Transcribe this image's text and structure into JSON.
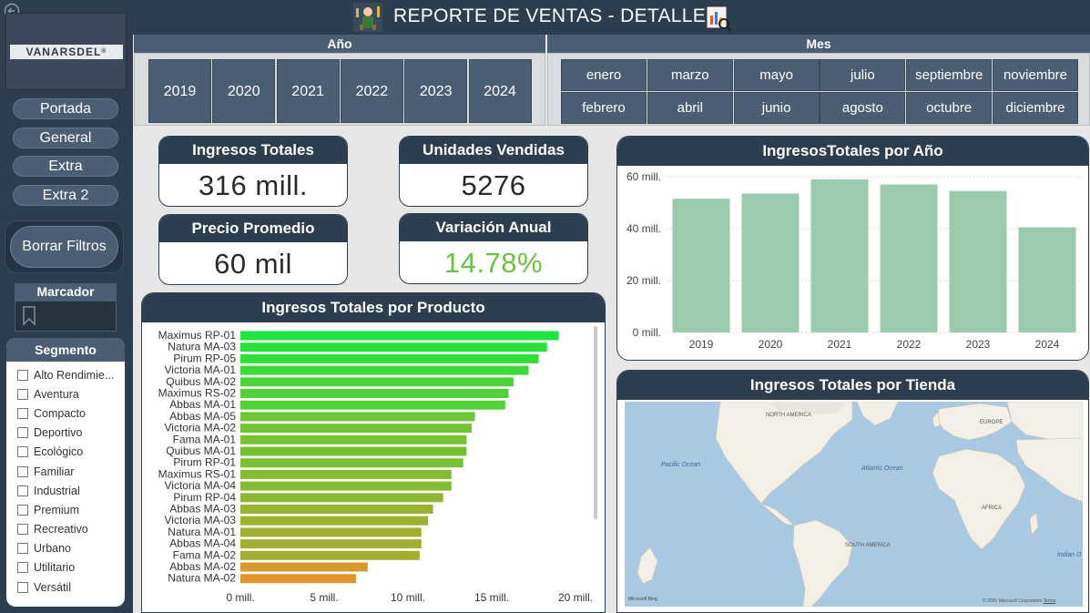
{
  "header": {
    "title": "REPORTE DE VENTAS - DETALLE",
    "left_icon": "sales-person-icon",
    "right_icon": "report-search-icon"
  },
  "sidebar": {
    "logo": "VANARSDEL",
    "logo_mark": "®",
    "nav": [
      "Portada",
      "General",
      "Extra",
      "Extra 2"
    ],
    "clear_filters": "Borrar Filtros",
    "bookmark_title": "Marcador",
    "segment_title": "Segmento",
    "segments": [
      "Alto Rendimie...",
      "Aventura",
      "Compacto",
      "Deportivo",
      "Ecológico",
      "Familiar",
      "Industrial",
      "Premium",
      "Recreativo",
      "Urbano",
      "Utilitario",
      "Versátil"
    ]
  },
  "filters": {
    "year_title": "Año",
    "years": [
      "2019",
      "2020",
      "2021",
      "2022",
      "2023",
      "2024"
    ],
    "month_title": "Mes",
    "months_row1": [
      "enero",
      "marzo",
      "mayo",
      "julio",
      "septiembre",
      "noviembre"
    ],
    "months_row2": [
      "febrero",
      "abril",
      "junio",
      "agosto",
      "octubre",
      "diciembre"
    ]
  },
  "kpis": {
    "ingresos": {
      "label": "Ingresos Totales",
      "value": "316 mill."
    },
    "unidades": {
      "label": "Unidades Vendidas",
      "value": "5276"
    },
    "precio": {
      "label": "Precio Promedio",
      "value": "60 mil"
    },
    "variacion": {
      "label": "Variación Anual",
      "value": "14.78%",
      "color": "#6cc142"
    }
  },
  "colors": {
    "bar_year": "#99cbac",
    "dark": "#2d3e50",
    "accent_slicer": "#4b5e74",
    "bar_green": "#1ee63c",
    "bar_orange": "#e0952a"
  },
  "chart_data": [
    {
      "type": "bar",
      "orientation": "horizontal",
      "title": "Ingresos Totales por Producto",
      "categories": [
        "Maximus RP-01",
        "Natura MA-03",
        "Pirum RP-05",
        "Victoria MA-01",
        "Quibus MA-02",
        "Maximus RS-02",
        "Abbas MA-01",
        "Abbas MA-05",
        "Victoria MA-02",
        "Fama MA-01",
        "Quibus MA-01",
        "Pirum RP-01",
        "Maximus RS-01",
        "Victoria MA-04",
        "Pirum RP-04",
        "Abbas MA-03",
        "Victoria MA-03",
        "Natura MA-01",
        "Abbas MA-04",
        "Fama MA-02",
        "Abbas MA-02",
        "Natura MA-02"
      ],
      "values": [
        19.0,
        18.3,
        17.8,
        17.2,
        16.3,
        16.0,
        15.8,
        14.0,
        13.8,
        13.5,
        13.5,
        13.3,
        12.6,
        12.6,
        12.1,
        11.5,
        11.2,
        10.8,
        10.8,
        10.7,
        7.6,
        6.9
      ],
      "unit": "mill.",
      "x_ticks": [
        "0 mill.",
        "5 mill.",
        "10 mill.",
        "15 mill.",
        "20 mill."
      ],
      "xlim": [
        0,
        20
      ],
      "color_scale": [
        "#1ee63c",
        "#e0952a"
      ]
    },
    {
      "type": "bar",
      "title": "IngresosTotales por Año",
      "categories": [
        "2019",
        "2020",
        "2021",
        "2022",
        "2023",
        "2024"
      ],
      "values": [
        51.5,
        53.5,
        59.0,
        57.0,
        54.5,
        40.5
      ],
      "unit": "mill.",
      "y_ticks": [
        "0 mill.",
        "20 mill.",
        "40 mill.",
        "60 mill."
      ],
      "ylim": [
        0,
        60
      ],
      "grid": true
    }
  ],
  "map": {
    "title": "Ingresos Totales por Tienda",
    "labels": [
      "NORTH AMERICA",
      "EUROPE",
      "Pacific Ocean",
      "Atlantic Ocean",
      "AFRICA",
      "SOUTH AMERICA",
      "Indian O"
    ],
    "brand": "Microsoft Bing",
    "copyright": "© 2025 Microsoft Corporation",
    "terms": "Terms"
  }
}
